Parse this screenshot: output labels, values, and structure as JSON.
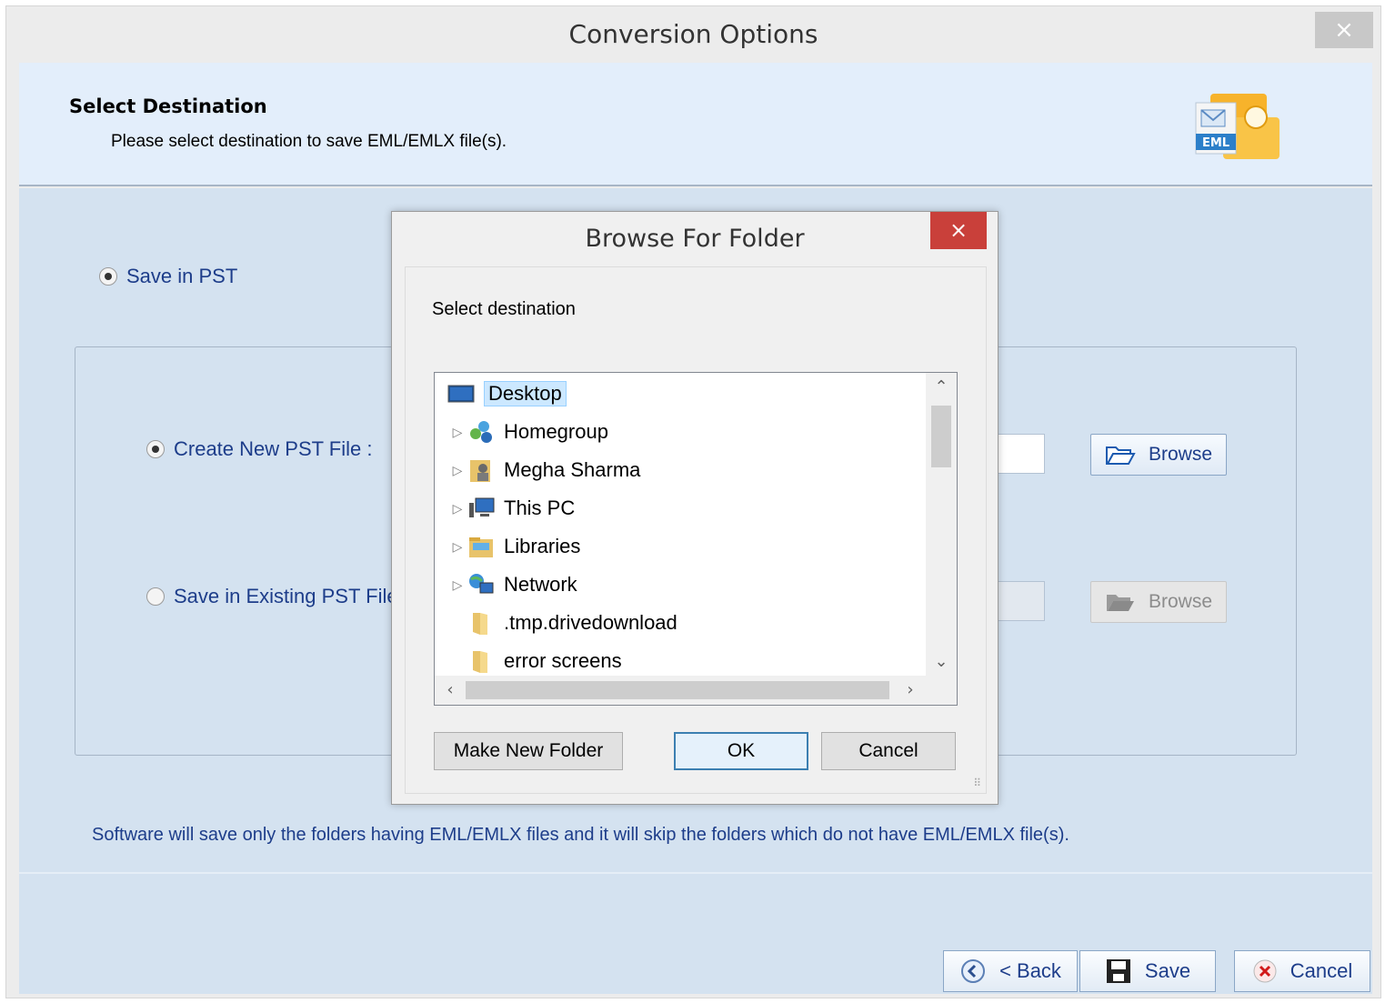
{
  "window": {
    "title": "Conversion Options",
    "close": "×"
  },
  "header": {
    "title": "Select Destination",
    "subtitle": "Please select destination to save EML/EMLX file(s).",
    "icon_label": "EML"
  },
  "options": {
    "save_in_pst": "Save in PST",
    "create_new": "Create New PST File :",
    "save_existing": "Save in Existing PST File",
    "browse1": "Browse",
    "browse2": "Browse"
  },
  "info": "Software will save only the folders having EML/EMLX files and it will skip the folders which do not have EML/EMLX file(s).",
  "footer": {
    "back": "< Back",
    "save": "Save",
    "cancel": "Cancel"
  },
  "dialog": {
    "title": "Browse For Folder",
    "close": "×",
    "label": "Select destination",
    "items": [
      {
        "label": "Desktop",
        "icon": "desktop-icon",
        "arrow": ""
      },
      {
        "label": "Homegroup",
        "icon": "homegroup-icon",
        "arrow": "▷"
      },
      {
        "label": "Megha Sharma",
        "icon": "user-folder-icon",
        "arrow": "▷"
      },
      {
        "label": "This PC",
        "icon": "computer-icon",
        "arrow": "▷"
      },
      {
        "label": "Libraries",
        "icon": "libraries-icon",
        "arrow": "▷"
      },
      {
        "label": "Network",
        "icon": "network-icon",
        "arrow": "▷"
      },
      {
        "label": ".tmp.drivedownload",
        "icon": "folder-icon",
        "arrow": ""
      },
      {
        "label": "error screens",
        "icon": "folder-icon",
        "arrow": ""
      }
    ],
    "make_new_folder": "Make New Folder",
    "ok": "OK",
    "cancel": "Cancel"
  }
}
